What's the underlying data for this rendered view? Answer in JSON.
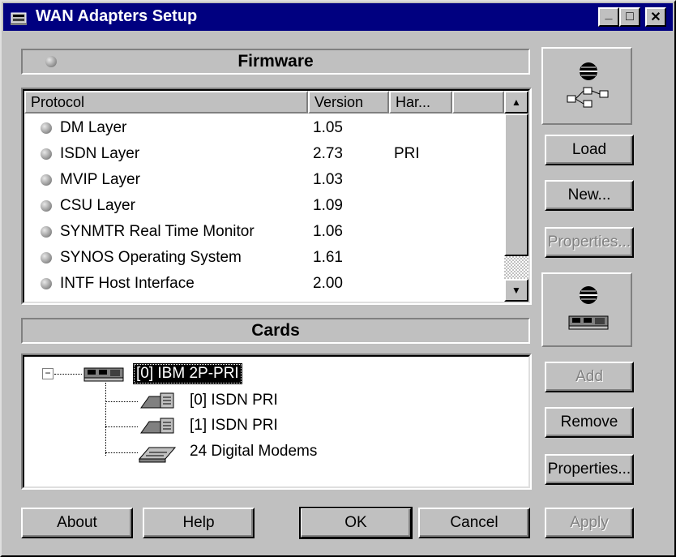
{
  "window": {
    "title": "WAN Adapters Setup",
    "minimize_glyph": "_",
    "maximize_glyph": "□",
    "close_glyph": "✕"
  },
  "firmware": {
    "section_title": "Firmware",
    "columns": [
      "Protocol",
      "Version",
      "Har..."
    ],
    "rows": [
      {
        "protocol": "DM Layer",
        "version": "1.05",
        "hardware": ""
      },
      {
        "protocol": "ISDN Layer",
        "version": "2.73",
        "hardware": "PRI"
      },
      {
        "protocol": "MVIP Layer",
        "version": "1.03",
        "hardware": ""
      },
      {
        "protocol": "CSU Layer",
        "version": "1.09",
        "hardware": ""
      },
      {
        "protocol": "SYNMTR Real Time Monitor",
        "version": "1.06",
        "hardware": ""
      },
      {
        "protocol": "SYNOS Operating System",
        "version": "1.61",
        "hardware": ""
      },
      {
        "protocol": "INTF Host Interface",
        "version": "2.00",
        "hardware": ""
      }
    ]
  },
  "cards": {
    "section_title": "Cards",
    "root": "[0] IBM 2P-PRI",
    "children": [
      "[0] ISDN PRI",
      "[1] ISDN PRI",
      "24 Digital Modems"
    ]
  },
  "side_buttons": {
    "load": "Load",
    "new": "New...",
    "properties_top": "Properties...",
    "add": "Add",
    "remove": "Remove",
    "properties_bottom": "Properties...",
    "apply": "Apply"
  },
  "bottom_buttons": {
    "about": "About",
    "help": "Help",
    "ok": "OK",
    "cancel": "Cancel"
  },
  "icons": {
    "title": "network-card-icon",
    "firmware_panel": "network-globe-icon",
    "cards_panel": "adapter-card-icon",
    "protocol_bullet": "gray-sphere-icon"
  },
  "colors": {
    "titlebar": "#000080",
    "face": "#c0c0c0",
    "selection": "#000000"
  }
}
